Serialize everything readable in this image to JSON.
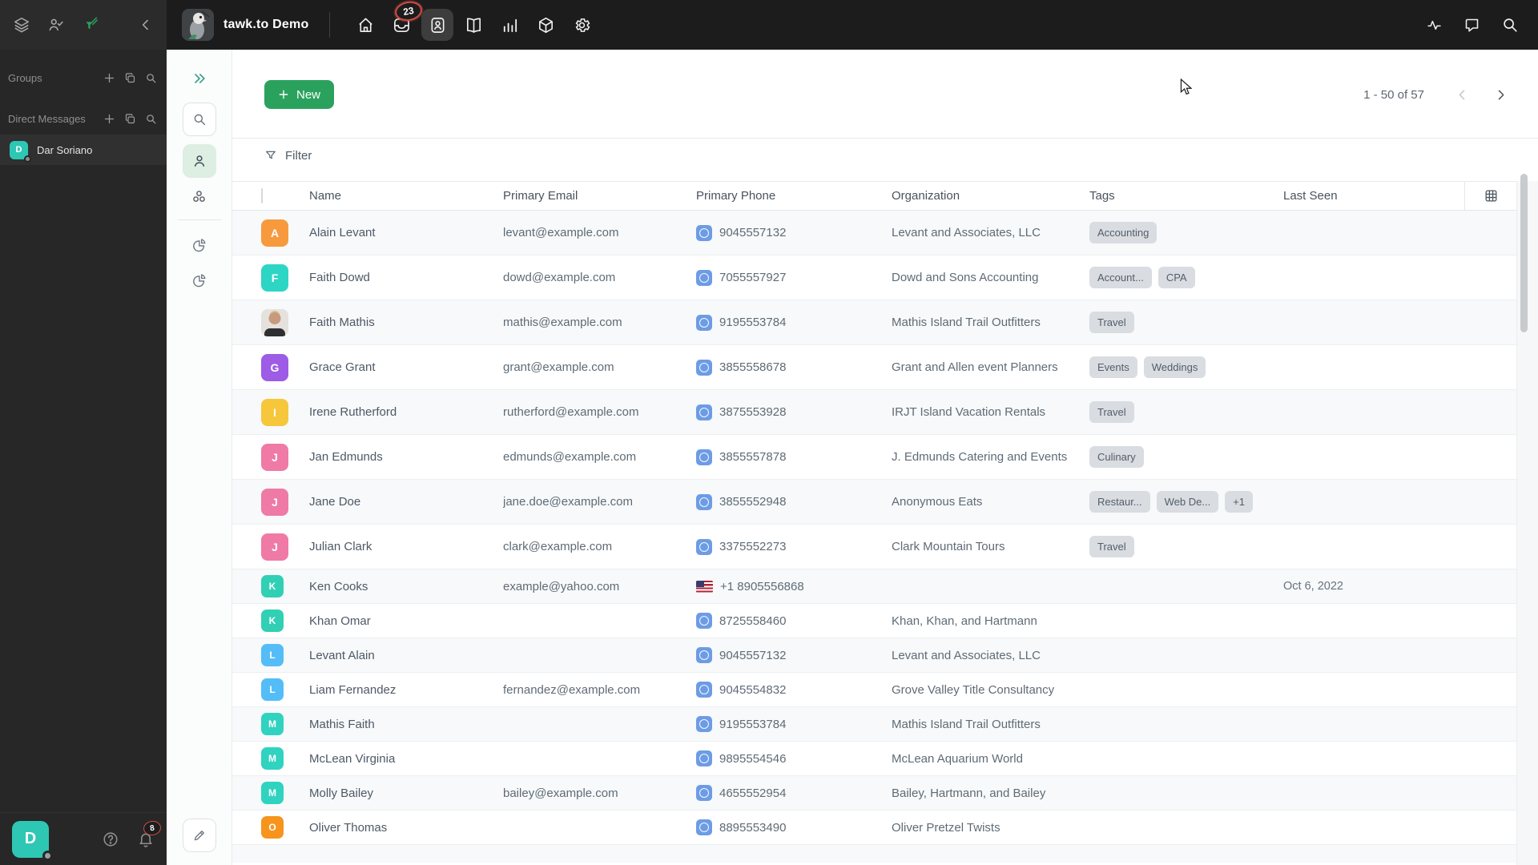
{
  "colors": {
    "accent": "#2aa25d",
    "chip_bg": "#d9dce1",
    "topbar_bg": "#1c1c1d",
    "sidebar_bg": "#272728",
    "avatar_teal": "#2ec7b4"
  },
  "topbar": {
    "title": "tawk.to Demo",
    "inbox_badge": "23",
    "nav_icons": [
      "home-icon",
      "inbox-icon",
      "contacts-icon",
      "knowledge-base-icon",
      "reporting-icon",
      "apps-icon",
      "settings-icon"
    ],
    "right_icons": [
      "activity-icon",
      "messages-icon",
      "search-icon"
    ]
  },
  "sidebar": {
    "groups_label": "Groups",
    "dm_label": "Direct Messages",
    "header_icons": [
      "plus-icon",
      "copy-icon",
      "search-icon"
    ],
    "dm_items": [
      {
        "name": "Dar Soriano",
        "avatar_letter": "D",
        "avatar_color": "#2ec7b4"
      }
    ],
    "user_initial": "D",
    "bell_badge": "8"
  },
  "rail": {
    "icons": [
      "collapse-icon",
      "search-icon",
      "contacts-person-icon",
      "companies-icon",
      "segment-icon",
      "segment-icon",
      "edit-icon"
    ]
  },
  "content": {
    "new_button": "New",
    "pagination": "1 - 50 of 57",
    "filter_label": "Filter",
    "table": {
      "columns": [
        "Name",
        "Primary Email",
        "Primary Phone",
        "Organization",
        "Tags",
        "Last Seen"
      ],
      "rows": [
        {
          "name": "Alain Levant",
          "avatar": {
            "letter": "A",
            "color": "#f79a3e"
          },
          "email": "levant@example.com",
          "phone": "9045557132",
          "flag": "generic",
          "org": "Levant and Associates, LLC",
          "tags": [
            "Accounting"
          ],
          "last_seen": ""
        },
        {
          "name": "Faith Dowd",
          "avatar": {
            "letter": "F",
            "color": "#2dd5c4"
          },
          "email": "dowd@example.com",
          "phone": "7055557927",
          "flag": "generic",
          "org": "Dowd and Sons Accounting",
          "tags": [
            "Account...",
            "CPA"
          ],
          "last_seen": ""
        },
        {
          "name": "Faith Mathis",
          "avatar": {
            "photo": true
          },
          "email": "mathis@example.com",
          "phone": "9195553784",
          "flag": "generic",
          "org": "Mathis Island Trail Outfitters",
          "tags": [
            "Travel"
          ],
          "last_seen": ""
        },
        {
          "name": "Grace Grant",
          "avatar": {
            "letter": "G",
            "color": "#9d5be6"
          },
          "email": "grant@example.com",
          "phone": "3855558678",
          "flag": "generic",
          "org": "Grant and Allen event Planners",
          "tags": [
            "Events",
            "Weddings"
          ],
          "last_seen": ""
        },
        {
          "name": "Irene Rutherford",
          "avatar": {
            "letter": "I",
            "color": "#f6c73b"
          },
          "email": "rutherford@example.com",
          "phone": "3875553928",
          "flag": "generic",
          "org": "IRJT Island Vacation Rentals",
          "tags": [
            "Travel"
          ],
          "last_seen": ""
        },
        {
          "name": "Jan Edmunds",
          "avatar": {
            "letter": "J",
            "color": "#ef7aa5"
          },
          "email": "edmunds@example.com",
          "phone": "3855557878",
          "flag": "generic",
          "org": "J. Edmunds Catering and Events",
          "tags": [
            "Culinary"
          ],
          "last_seen": ""
        },
        {
          "name": "Jane Doe",
          "avatar": {
            "letter": "J",
            "color": "#ef7aa5"
          },
          "email": "jane.doe@example.com",
          "phone": "3855552948",
          "flag": "generic",
          "org": "Anonymous Eats",
          "tags": [
            "Restaur...",
            "Web De...",
            "+1"
          ],
          "last_seen": ""
        },
        {
          "name": "Julian Clark",
          "avatar": {
            "letter": "J",
            "color": "#ef7aa5"
          },
          "email": "clark@example.com",
          "phone": "3375552273",
          "flag": "generic",
          "org": "Clark Mountain Tours",
          "tags": [
            "Travel"
          ],
          "last_seen": ""
        },
        {
          "name": "Ken Cooks",
          "avatar": {
            "letter": "K",
            "color": "#31d0b5"
          },
          "email": "example@yahoo.com",
          "phone": "+1 8905556868",
          "flag": "us",
          "org": "",
          "tags": [],
          "last_seen": "Oct 6, 2022"
        },
        {
          "name": "Khan Omar",
          "avatar": {
            "letter": "K",
            "color": "#31d0b5"
          },
          "email": "",
          "phone": "8725558460",
          "flag": "generic",
          "org": "Khan, Khan, and Hartmann",
          "tags": [],
          "last_seen": ""
        },
        {
          "name": "Levant Alain",
          "avatar": {
            "letter": "L",
            "color": "#54bdf7"
          },
          "email": "",
          "phone": "9045557132",
          "flag": "generic",
          "org": "Levant and Associates, LLC",
          "tags": [],
          "last_seen": ""
        },
        {
          "name": "Liam Fernandez",
          "avatar": {
            "letter": "L",
            "color": "#54bdf7"
          },
          "email": "fernandez@example.com",
          "phone": "9045554832",
          "flag": "generic",
          "org": "Grove Valley Title Consultancy",
          "tags": [],
          "last_seen": ""
        },
        {
          "name": "Mathis Faith",
          "avatar": {
            "letter": "M",
            "color": "#30d3c0"
          },
          "email": "",
          "phone": "9195553784",
          "flag": "generic",
          "org": "Mathis Island Trail Outfitters",
          "tags": [],
          "last_seen": ""
        },
        {
          "name": "McLean Virginia",
          "avatar": {
            "letter": "M",
            "color": "#30d3c0"
          },
          "email": "",
          "phone": "9895554546",
          "flag": "generic",
          "org": "McLean Aquarium World",
          "tags": [],
          "last_seen": ""
        },
        {
          "name": "Molly Bailey",
          "avatar": {
            "letter": "M",
            "color": "#30d3c0"
          },
          "email": "bailey@example.com",
          "phone": "4655552954",
          "flag": "generic",
          "org": "Bailey, Hartmann, and Bailey",
          "tags": [],
          "last_seen": ""
        },
        {
          "name": "Oliver Thomas",
          "avatar": {
            "letter": "O",
            "color": "#f7941e"
          },
          "email": "",
          "phone": "8895553490",
          "flag": "generic",
          "org": "Oliver Pretzel Twists",
          "tags": [],
          "last_seen": ""
        }
      ]
    }
  }
}
